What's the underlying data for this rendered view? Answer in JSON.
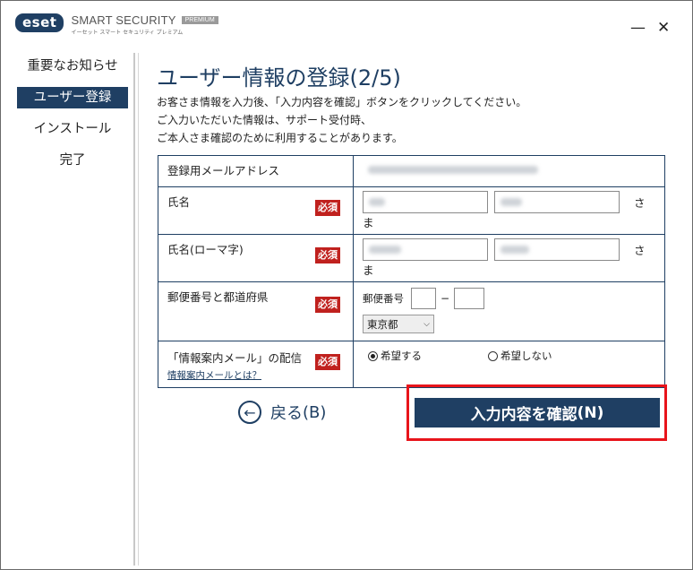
{
  "window": {
    "brand": "eset",
    "product": "SMART SECURITY",
    "edition": "PREMIUM",
    "tagline": "イーセット スマート セキュリティ プレミアム",
    "minimize": "—",
    "close": "✕"
  },
  "sidebar": {
    "items": [
      {
        "label": "重要なお知らせ",
        "active": false
      },
      {
        "label": "ユーザー登録",
        "active": true
      },
      {
        "label": "インストール",
        "active": false
      },
      {
        "label": "完了",
        "active": false
      }
    ]
  },
  "main": {
    "title": "ユーザー情報の登録(2/5)",
    "description": [
      "お客さま情報を入力後、「入力内容を確認」ボタンをクリックしてください。",
      "ご入力いただいた情報は、サポート受付時、",
      "ご本人さま確認のために利用することがあります。"
    ]
  },
  "form": {
    "required_label": "必須",
    "honorific": "さま",
    "rows": {
      "email": {
        "label": "登録用メールアドレス"
      },
      "name": {
        "label": "氏名"
      },
      "name_roman": {
        "label": "氏名(ローマ字)"
      },
      "postal": {
        "label": "郵便番号と都道府県",
        "postal_label": "郵便番号",
        "dash": "−",
        "prefecture": "東京都"
      },
      "newsletter": {
        "label": "「情報案内メール」の配信",
        "link": "情報案内メールとは？",
        "option_yes": "希望する",
        "option_no": "希望しない",
        "selected": "希望する"
      }
    }
  },
  "buttons": {
    "back_label": "戻る",
    "back_shortcut": "(B)",
    "confirm_label": "入力内容を確認",
    "confirm_shortcut": "(N)"
  },
  "colors": {
    "accent": "#1f3f63",
    "required": "#c0211e",
    "highlight": "#e8141b"
  }
}
